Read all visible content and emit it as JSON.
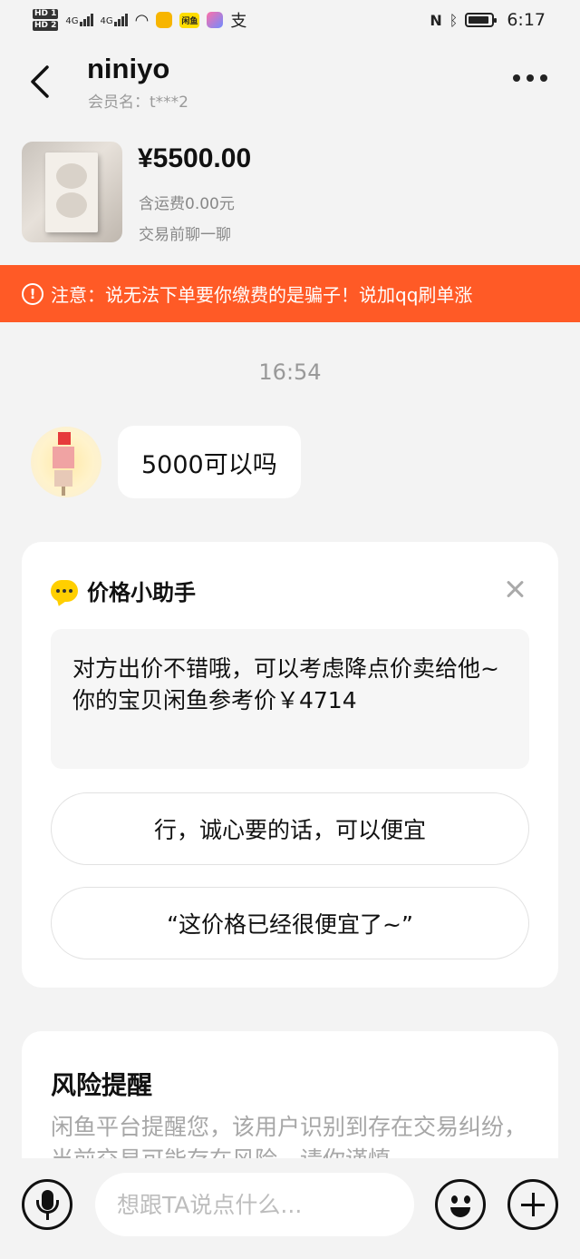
{
  "status_bar": {
    "hd1": "HD 1",
    "hd2": "HD 2",
    "net1": "4G",
    "net2": "4G",
    "app_icon_label": "闲鱼",
    "alipay_label": "支",
    "time": "6:17",
    "icons": [
      "nfc-icon",
      "bluetooth-icon",
      "battery-icon",
      "wifi-icon",
      "signal-icon"
    ]
  },
  "header": {
    "title": "niniyo",
    "member_label": "会员名：t***2"
  },
  "product": {
    "price": "¥5500.00",
    "shipping": "含运费0.00元",
    "prompt": "交易前聊一聊"
  },
  "warning": {
    "icon": "!",
    "text": "注意：说无法下单要你缴费的是骗子！说加qq刷单涨"
  },
  "chat": {
    "time": "16:54",
    "message": "5000可以吗"
  },
  "price_helper": {
    "title": "价格小助手",
    "message_line1": "对方出价不错哦，可以考虑降点价卖给他~",
    "message_line2": "你的宝贝闲鱼参考价￥4714",
    "option1": "行，诚心要的话，可以便宜",
    "option2": "“这价格已经很便宜了~”"
  },
  "risk": {
    "title": "风险提醒",
    "text": "闲鱼平台提醒您，该用户识别到存在交易纠纷，当前交易可能存在风险，请你谨慎"
  },
  "input": {
    "placeholder": "想跟TA说点什么..."
  },
  "colors": {
    "warning_bg": "#ff5a26",
    "helper_icon": "#ffcf00",
    "page_bg": "#f3f3f3"
  }
}
